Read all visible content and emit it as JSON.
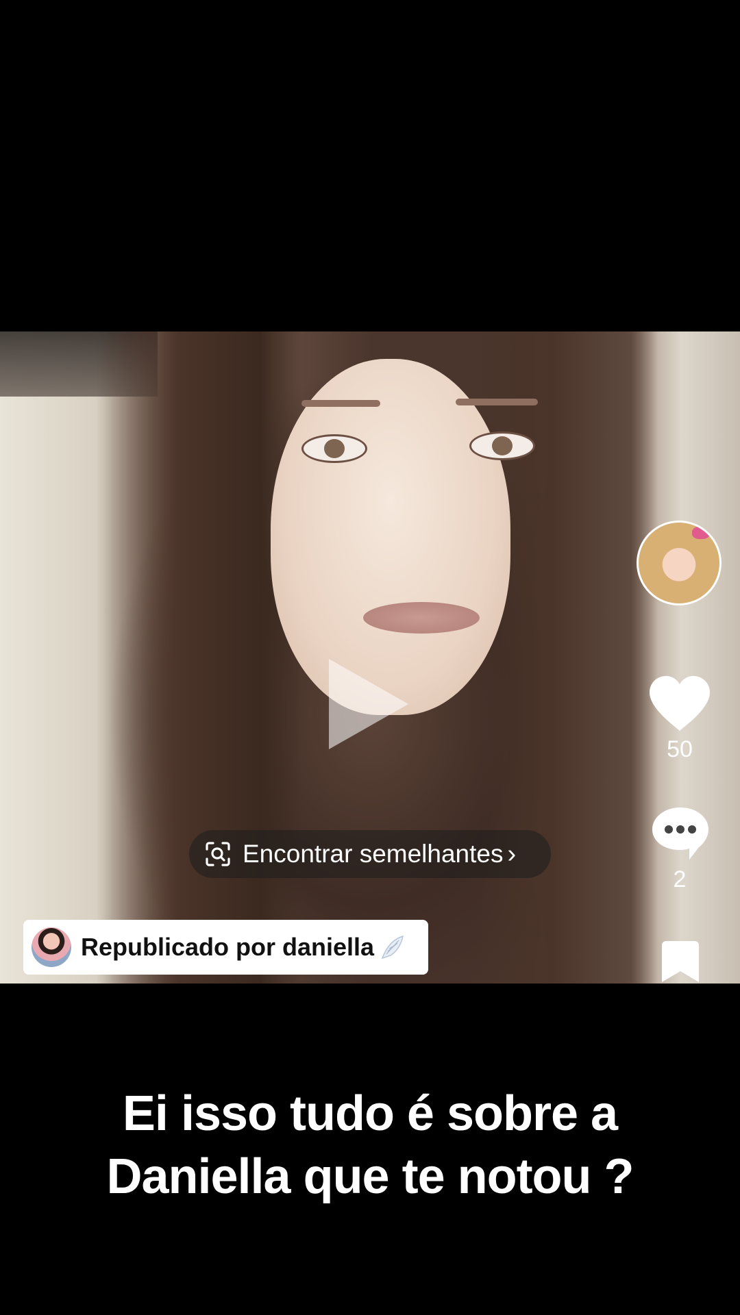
{
  "video": {
    "find_similar_label": "Encontrar semelhantes",
    "find_similar_chevron": "›",
    "repost_text": "Republicado por daniella"
  },
  "actions": {
    "like_count": "50",
    "comment_count": "2"
  },
  "caption": {
    "line1": "Ei isso tudo é sobre a",
    "line2": "Daniella que te notou ?"
  },
  "icons": {
    "play": "play-icon",
    "scan": "scan-search-icon",
    "wing": "wing-icon",
    "like": "heart-icon",
    "comment": "comment-bubble-icon",
    "bookmark": "bookmark-icon"
  }
}
